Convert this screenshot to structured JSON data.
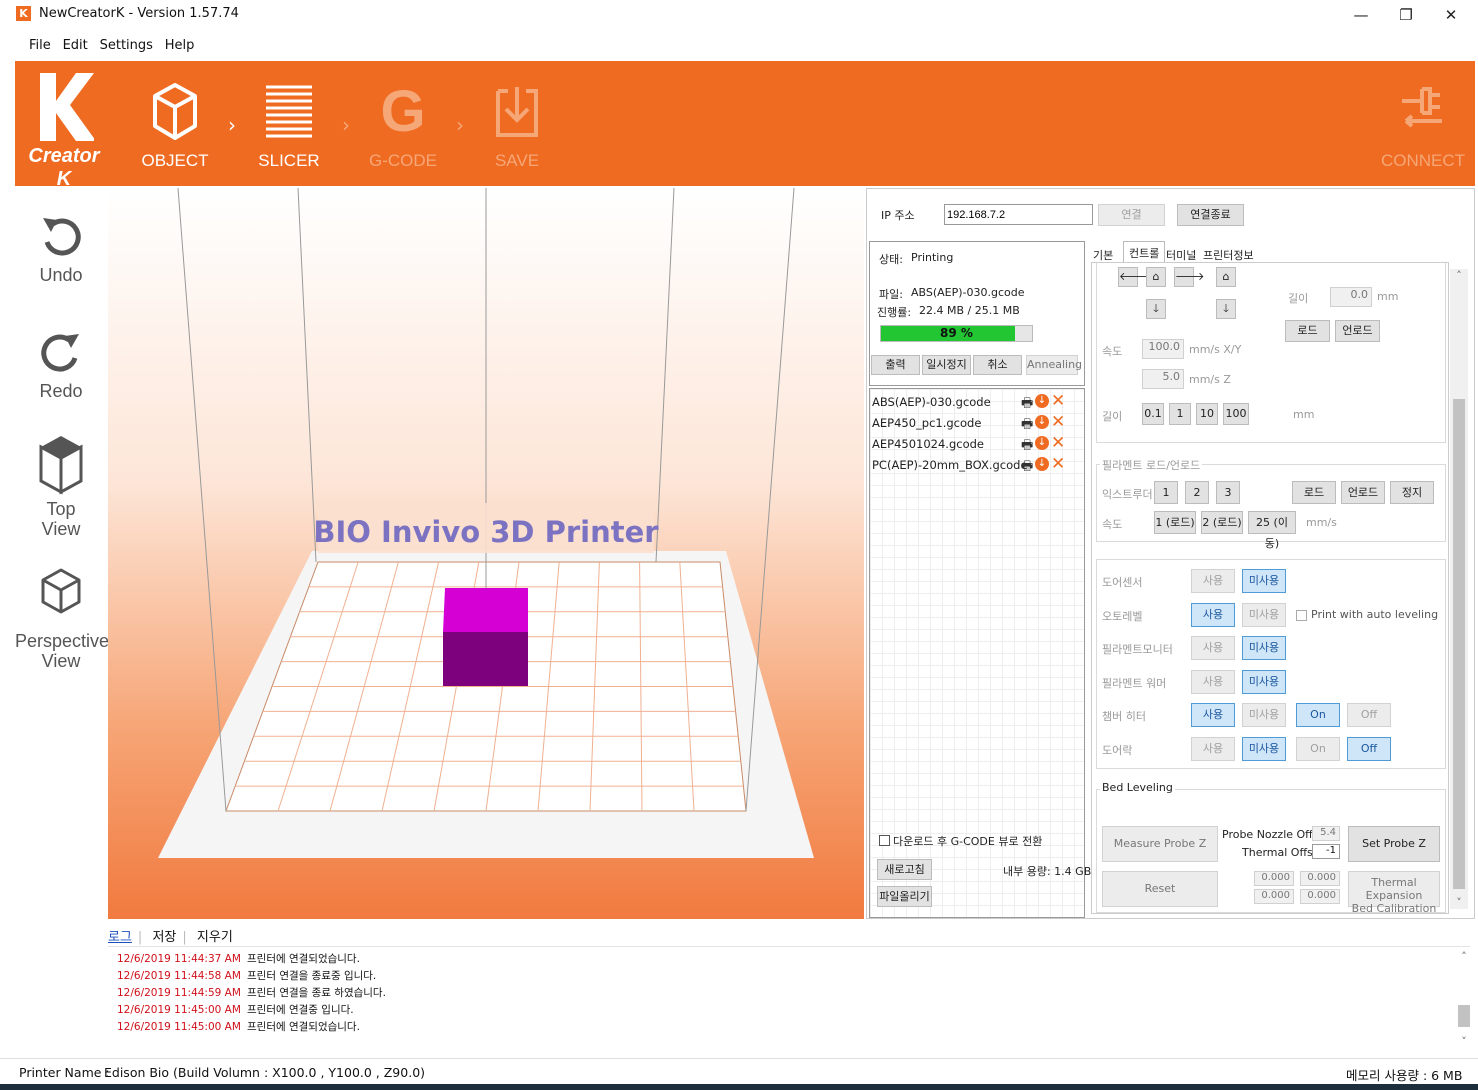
{
  "window": {
    "title": "NewCreatorK - Version 1.57.74",
    "logo_letter": "K"
  },
  "menu": [
    "File",
    "Edit",
    "Settings",
    "Help"
  ],
  "toolbar": {
    "brand": "Creator K",
    "steps": [
      {
        "label": "OBJECT",
        "active": true
      },
      {
        "label": "SLICER",
        "active": true
      },
      {
        "label": "G-CODE",
        "active": false
      },
      {
        "label": "SAVE",
        "active": false
      }
    ],
    "connect": "CONNECT",
    "accent": "#ef6b22"
  },
  "sidebar": {
    "undo": "Undo",
    "redo": "Redo",
    "top_view": [
      "Top",
      "View"
    ],
    "perspective_view": [
      "Perspective",
      "View"
    ]
  },
  "viewport": {
    "banner": "BIO Invivo 3D Printer",
    "object_color": "#cc00cc"
  },
  "connection": {
    "ip_label": "IP 주소",
    "ip_value": "192.168.7.2",
    "connect": "연결",
    "disconnect": "연결종료"
  },
  "status": {
    "state_label": "상태:",
    "state_value": "Printing",
    "file_label": "파일:",
    "file_value": "ABS(AEP)-030.gcode",
    "progress_label": "진행률:",
    "progress_value": "22.4 MB / 25.1 MB",
    "progress_percent": 89,
    "progress_text": "89 %",
    "buttons": [
      "출력",
      "일시정지",
      "취소",
      "Annealing"
    ]
  },
  "files": [
    "ABS(AEP)-030.gcode",
    "AEP450_pc1.gcode",
    "AEP4501024.gcode",
    "PC(AEP)-20mm_BOX.gcode"
  ],
  "filebox": {
    "download_label": "다운로드 후 G-CODE 뷰로 전환",
    "refresh": "새로고침",
    "upload": "파일올리기",
    "storage": "내부 용량: 1.4 GB"
  },
  "tabs": [
    "기본",
    "컨트롤",
    "터미널",
    "프린터정보"
  ],
  "control": {
    "length_label": "길이",
    "length_value": "0.0",
    "length_unit": "mm",
    "load": "로드",
    "unload": "언로드",
    "speed_label": "속도",
    "speed_xy": "100.0",
    "speed_xy_unit": "mm/s X/Y",
    "speed_z": "5.0",
    "speed_z_unit": "mm/s Z",
    "step_label": "길이",
    "steps": [
      "0.1",
      "1",
      "10",
      "100"
    ],
    "step_unit": "mm",
    "filament_group": "필라멘트 로드/언로드",
    "extruder_label": "익스트루더",
    "extruders": [
      "1",
      "2",
      "3"
    ],
    "fil_load": "로드",
    "fil_unload": "언로드",
    "fil_stop": "정지",
    "fil_speed_label": "속도",
    "fil_speeds": [
      "1 (로드)",
      "2 (로드)",
      "25 (이동)"
    ],
    "fil_speed_unit": "mm/s"
  },
  "settings": [
    {
      "label": "도어센서",
      "use": "사용",
      "nouse": "미사용",
      "active": "nouse"
    },
    {
      "label": "오토레벨",
      "use": "사용",
      "nouse": "미사용",
      "active": "use",
      "extra": "Print with auto leveling"
    },
    {
      "label": "필라멘트모니터",
      "use": "사용",
      "nouse": "미사용",
      "active": "nouse"
    },
    {
      "label": "필라멘트 워머",
      "use": "사용",
      "nouse": "미사용",
      "active": "nouse"
    },
    {
      "label": "챔버 히터",
      "use": "사용",
      "nouse": "미사용",
      "active": "use",
      "on": "On",
      "off": "Off",
      "onoff": "on"
    },
    {
      "label": "도어락",
      "use": "사용",
      "nouse": "미사용",
      "active": "nouse",
      "on": "On",
      "off": "Off",
      "onoff": "off"
    }
  ],
  "bed": {
    "title": "Bed Leveling",
    "measure": "Measure Probe Z Offset",
    "probe_label": "Probe Nozzle Offset",
    "probe_value": "5.4",
    "thermal_label": "Thermal Offset",
    "thermal_value": "-1",
    "set": "Set Probe Z Offset",
    "reset": "Reset",
    "vals": [
      "0.000",
      "0.000",
      "0.000",
      "0.000"
    ],
    "calib": [
      "Thermal Expansion",
      "Bed Calibration"
    ]
  },
  "log": {
    "tabs": [
      "로그",
      "저장",
      "지우기"
    ],
    "entries": [
      {
        "ts": "12/6/2019 11:44:37 AM",
        "msg": "프린터에 연결되었습니다."
      },
      {
        "ts": "12/6/2019 11:44:58 AM",
        "msg": "프린터 연결을 종료중 입니다."
      },
      {
        "ts": "12/6/2019 11:44:59 AM",
        "msg": "프린터 연결을 종료 하였습니다."
      },
      {
        "ts": "12/6/2019 11:45:00 AM",
        "msg": "프린터에 연결중 입니다."
      },
      {
        "ts": "12/6/2019 11:45:00 AM",
        "msg": "프린터에 연결되었습니다."
      }
    ]
  },
  "statusbar": {
    "printer_label": "Printer Name :",
    "printer_value": "Edison Bio (Build Volumn : X100.0 , Y100.0 , Z90.0)",
    "memory": "메모리 사용량 : 6 MB"
  }
}
